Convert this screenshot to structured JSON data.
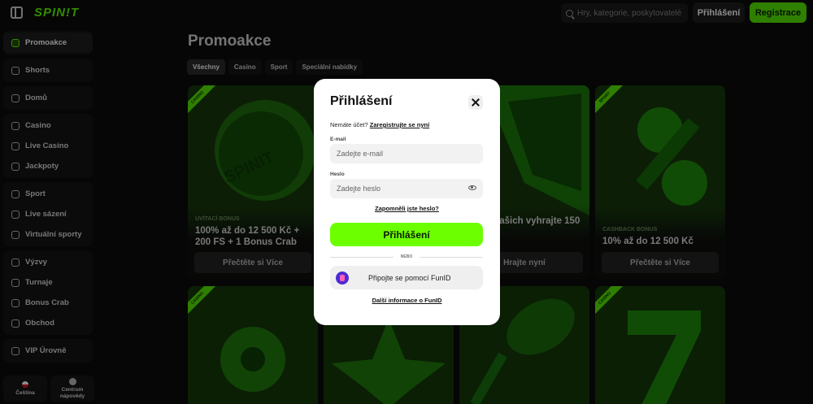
{
  "header": {
    "logo": "SPIN!T",
    "search_placeholder": "Hry, kategorie, poskytovatelé",
    "login_label": "Přihlášení",
    "register_label": "Registrace"
  },
  "sidebar": {
    "groups": [
      [
        {
          "label": "Promoakce",
          "icon": "gift-icon",
          "active": true
        }
      ],
      [
        {
          "label": "Shorts",
          "icon": "shorts-icon"
        }
      ],
      [
        {
          "label": "Domů",
          "icon": "home-icon"
        }
      ],
      [
        {
          "label": "Casino",
          "icon": "slot-icon"
        },
        {
          "label": "Live Casino",
          "icon": "cards-icon"
        },
        {
          "label": "Jackpoty",
          "icon": "jackpot-icon"
        }
      ],
      [
        {
          "label": "Sport",
          "icon": "ball-icon"
        },
        {
          "label": "Live sázení",
          "icon": "live-icon"
        },
        {
          "label": "Virtuální sporty",
          "icon": "virtual-icon"
        }
      ],
      [
        {
          "label": "Výzvy",
          "icon": "challenge-icon"
        },
        {
          "label": "Turnaje",
          "icon": "trophy-icon"
        },
        {
          "label": "Bonus Crab",
          "icon": "crab-icon"
        },
        {
          "label": "Obchod",
          "icon": "shop-icon"
        }
      ],
      [
        {
          "label": "VIP Úrovně",
          "icon": "vip-icon"
        }
      ]
    ],
    "language_label": "Čeština",
    "help_label": "Centrum nápovědy"
  },
  "main": {
    "title": "Promoakce",
    "tabs": [
      "Všechny",
      "Casino",
      "Sport",
      "Speciální nabídky"
    ],
    "cards": [
      {
        "badge": "CASINO",
        "category": "UVÍTACÍ BONUS",
        "title": "100% až do 12 500 Kč + 200 FS + 1 Bonus Crab",
        "button": "Přečtěte si Více",
        "art_text": "SPINIT"
      },
      {
        "badge": "SPORT",
        "category": "",
        "title": "se do našich vyhrajte 150 000",
        "button": "Hrajte nyní"
      },
      {
        "badge": "SPORT",
        "category": "CASHBACK BONUS",
        "title": "10% až do 12 500 Kč",
        "button": "Přečtěte si Více"
      }
    ],
    "row2_badges": [
      "CASINO",
      "CASINO"
    ]
  },
  "modal": {
    "title": "Přihlášení",
    "no_account_text": "Nemáte účet?",
    "register_link": "Zaregistrujte se nyní",
    "email_label": "E-mail",
    "email_placeholder": "Zadejte e-mail",
    "password_label": "Heslo",
    "password_placeholder": "Zadejte heslo",
    "forgot_link": "Zapomněli jste heslo?",
    "submit_label": "Přihlášení",
    "or_text": "NEBO",
    "funid_label": "Připojte se pomocí FunID",
    "funid_more_link": "Další informace o FunID"
  },
  "colors": {
    "accent": "#5cff00",
    "background": "#0b0b0b",
    "modal": "#ffffff"
  }
}
